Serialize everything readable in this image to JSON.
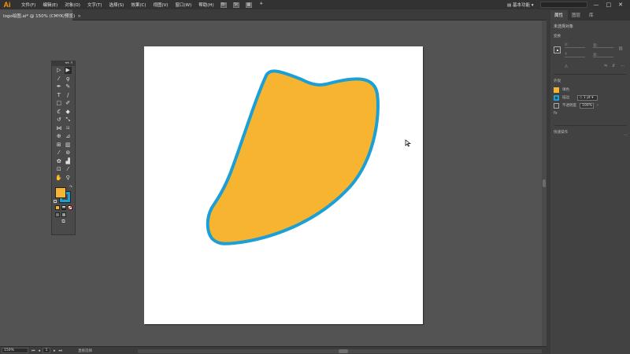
{
  "app": {
    "logo": "Ai",
    "menus": [
      "文件(F)",
      "编辑(E)",
      "对象(O)",
      "文字(T)",
      "选择(S)",
      "效果(C)",
      "视图(V)",
      "窗口(W)",
      "帮助(H)"
    ],
    "toolbar_icons": [
      "Br",
      "St"
    ],
    "workspace": "基本功能",
    "window_controls": [
      "—",
      "□",
      "✕"
    ]
  },
  "document": {
    "tab_title": "logo绘图.ai* @ 150% (CMYK/预览)",
    "close_glyph": "×"
  },
  "canvas": {
    "shape": {
      "fill": "#f7b430",
      "stroke": "#1b9fd4",
      "artboard_bg": "#ffffff"
    }
  },
  "tools": {
    "icons": [
      "selection-icon",
      "direct-selection-icon",
      "magic-wand-icon",
      "lasso-icon",
      "pen-icon",
      "curvature-icon",
      "type-icon",
      "line-segment-icon",
      "rectangle-icon",
      "paintbrush-icon",
      "shaper-icon",
      "eraser-icon",
      "rotate-icon",
      "scale-icon",
      "width-icon",
      "free-transform-icon",
      "shape-builder-icon",
      "perspective-grid-icon",
      "mesh-icon",
      "gradient-icon",
      "eyedropper-icon",
      "blend-icon",
      "symbol-sprayer-icon",
      "column-graph-icon",
      "artboard-icon",
      "slice-icon",
      "hand-icon",
      "zoom-icon"
    ],
    "fill_color": "#f7b430",
    "stroke_color": "#1b9fd4"
  },
  "panel": {
    "tabs": [
      "属性",
      "图层",
      "库"
    ],
    "selection_label": "未选择对象",
    "transform_label": "变换",
    "coords": {
      "x_label": "X:",
      "y_label": "Y:",
      "w_label": "宽:",
      "h_label": "高:"
    },
    "appearance_label": "外观",
    "fill_label": "填色",
    "stroke_label": "描边",
    "stroke_weight": "1 pt",
    "opacity_label": "不透明度",
    "opacity_value": "100%",
    "fx_label": "fx",
    "quick_actions_label": "快速操作"
  },
  "status": {
    "zoom": "150%",
    "page": "1",
    "tool_status": "直接选择"
  }
}
